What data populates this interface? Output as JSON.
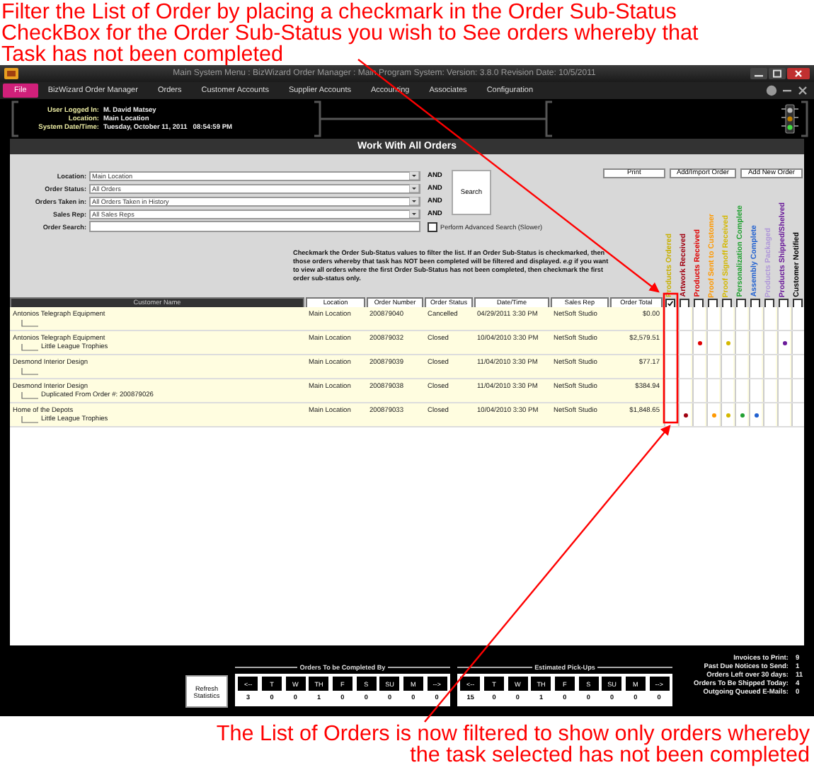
{
  "annotation_top": [
    "Filter the List of Order by placing a checkmark in the Order Sub-Status",
    "CheckBox for the Order Sub-Status you wish to See orders whereby that",
    "Task has not been completed"
  ],
  "window": {
    "title": "Main System Menu : BizWizard Order Manager : Main Program System: Version: 3.8.0  Revision Date: 10/5/2011"
  },
  "menu": [
    {
      "label": "File",
      "selected": true
    },
    {
      "label": "BizWizard Order Manager",
      "selected": false
    },
    {
      "label": "Orders",
      "selected": false
    },
    {
      "label": "Customer Accounts",
      "selected": false
    },
    {
      "label": "Supplier Accounts",
      "selected": false
    },
    {
      "label": "Accounting",
      "selected": false
    },
    {
      "label": "Associates",
      "selected": false
    },
    {
      "label": "Configuration",
      "selected": false
    }
  ],
  "session": [
    {
      "label": "User Logged In:",
      "value": "M. David Matsey"
    },
    {
      "label": "Location:",
      "value": "Main Location"
    },
    {
      "label": "System Date/Time:",
      "value": "Tuesday, October 11, 2011   08:54:59 PM"
    }
  ],
  "panel_title": "Work With All Orders",
  "filters": [
    {
      "label": "Location:",
      "value": "Main Location",
      "conjunction": "AND"
    },
    {
      "label": "Order Status:",
      "value": "All Orders",
      "conjunction": "AND"
    },
    {
      "label": "Orders Taken in:",
      "value": "All Orders Taken in History",
      "conjunction": "AND"
    },
    {
      "label": "Sales Rep:",
      "value": "All Sales Reps",
      "conjunction": "AND"
    }
  ],
  "order_search": {
    "label": "Order Search:"
  },
  "advanced_search": {
    "label": "Perform Advanced Search (Slower)",
    "checked": false
  },
  "search_button": "Search",
  "actions": [
    "Print",
    "Add/Import Order",
    "Add New Order"
  ],
  "help_text": "Checkmark the Order Sub-Status values to filter the list.  If an Order Sub-Status is checkmarked, then those orders whereby that task has NOT been completed will be filtered and displayed.  *e.g* if you want to view all orders where the first Order Sub-Status has not been completed, then checkmark the first order sub-status only.",
  "columns": [
    "Customer Name",
    "Location",
    "Order Number",
    "Order Status",
    "Date/Time",
    "Sales Rep",
    "Order Total"
  ],
  "substatuses": [
    {
      "label": "Products Ordered",
      "color": "#c8b000",
      "checked": true
    },
    {
      "label": "Artwork Received",
      "color": "#a00010",
      "checked": false
    },
    {
      "label": "Products Received",
      "color": "#e00000",
      "checked": false
    },
    {
      "label": "Proof Sent to Customer",
      "color": "#ff9900",
      "checked": false
    },
    {
      "label": "Proof Signoff Received",
      "color": "#d4b800",
      "checked": false
    },
    {
      "label": "Personalization Complete",
      "color": "#20a030",
      "checked": false
    },
    {
      "label": "Assembly Complete",
      "color": "#2060d0",
      "checked": false
    },
    {
      "label": "Products Packaged",
      "color": "#b098d8",
      "checked": false
    },
    {
      "label": "Products Shipped/Shelved",
      "color": "#6a1a9a",
      "checked": false
    },
    {
      "label": "Customer Notified",
      "color": "#000000",
      "checked": false
    }
  ],
  "rows": [
    {
      "customer": "Antonios Telegraph Equipment",
      "location": "Main Location",
      "order_number": "200879040",
      "status": "Cancelled",
      "date_time": "04/29/2011 3:30 PM",
      "sales_rep": "NetSoft Studio",
      "total": "$0.00",
      "done": [
        false,
        false,
        false,
        false,
        false,
        false,
        false,
        false,
        false,
        false
      ]
    },
    {
      "customer": "Antonios Telegraph Equipment",
      "sub": "Little League Trophies",
      "location": "Main Location",
      "order_number": "200879032",
      "status": "Closed",
      "date_time": "10/04/2010 3:30 PM",
      "sales_rep": "NetSoft Studio",
      "total": "$2,579.51",
      "done": [
        false,
        false,
        true,
        false,
        true,
        false,
        false,
        false,
        true,
        false
      ]
    },
    {
      "customer": "Desmond Interior Design",
      "location": "Main Location",
      "order_number": "200879039",
      "status": "Closed",
      "date_time": "11/04/2010 3:30 PM",
      "sales_rep": "NetSoft Studio",
      "total": "$77.17",
      "done": [
        false,
        false,
        false,
        false,
        false,
        false,
        false,
        false,
        false,
        false
      ]
    },
    {
      "customer": "Desmond Interior Design",
      "sub": "Duplicated From Order #: 200879026",
      "location": "Main Location",
      "order_number": "200879038",
      "status": "Closed",
      "date_time": "11/04/2010 3:30 PM",
      "sales_rep": "NetSoft Studio",
      "total": "$384.94",
      "done": [
        false,
        false,
        false,
        false,
        false,
        false,
        false,
        false,
        false,
        false
      ]
    },
    {
      "customer": "Home of the Depots",
      "sub": "Little League Trophies",
      "location": "Main Location",
      "order_number": "200879033",
      "status": "Closed",
      "date_time": "10/04/2010 3:30 PM",
      "sales_rep": "NetSoft Studio",
      "total": "$1,848.65",
      "done": [
        false,
        true,
        false,
        true,
        true,
        true,
        true,
        false,
        false,
        false
      ]
    }
  ],
  "refresh_button": "Refresh Statistics",
  "day_groups": [
    {
      "title": "Orders To be Completed By",
      "days": [
        "<--",
        "T",
        "W",
        "TH",
        "F",
        "S",
        "SU",
        "M",
        "-->"
      ],
      "counts": [
        "3",
        "0",
        "0",
        "1",
        "0",
        "0",
        "0",
        "0",
        "0"
      ]
    },
    {
      "title": "Estimated Pick-Ups",
      "days": [
        "<--",
        "T",
        "W",
        "TH",
        "F",
        "S",
        "SU",
        "M",
        "-->"
      ],
      "counts": [
        "15",
        "0",
        "0",
        "1",
        "0",
        "0",
        "0",
        "0",
        "0"
      ]
    }
  ],
  "summary": [
    {
      "label": "Invoices to Print:",
      "value": "9"
    },
    {
      "label": "Past Due Notices to Send:",
      "value": "1"
    },
    {
      "label": "Orders Left over 30 days:",
      "value": "11"
    },
    {
      "label": "Orders To Be Shipped Today:",
      "value": "4"
    },
    {
      "label": "Outgoing Queued E-Mails:",
      "value": "0"
    }
  ],
  "annotation_bottom": [
    "The List of Orders is now filtered to show only orders whereby",
    "the task selected has not been completed"
  ]
}
